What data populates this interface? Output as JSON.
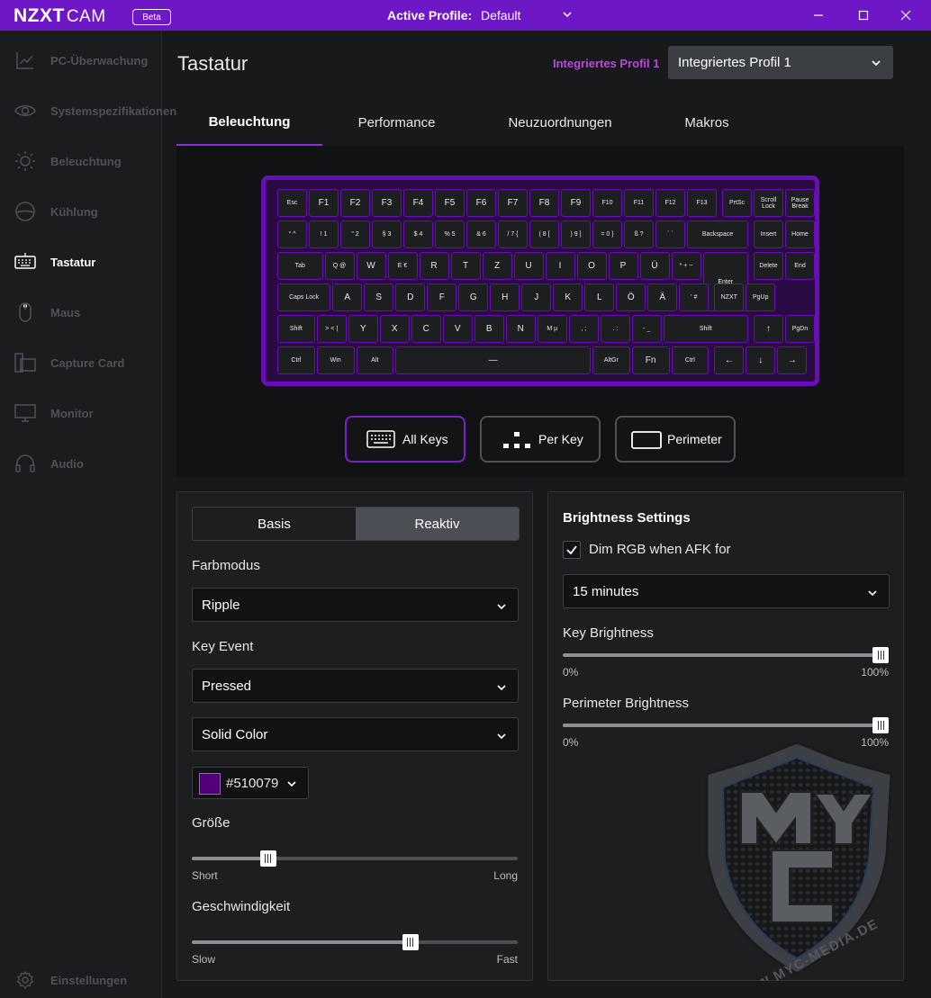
{
  "app": {
    "logo": "NZXT",
    "logo_suffix": "CAM",
    "badge": "Beta"
  },
  "titlebar": {
    "profile_label": "Active Profile:",
    "profile_value": "Default"
  },
  "sidebar": {
    "items": [
      {
        "label": "PC-Überwachung",
        "icon": "chart-line-icon"
      },
      {
        "label": "Systemspezifikationen",
        "icon": "eye-icon"
      },
      {
        "label": "Beleuchtung",
        "icon": "sun-icon"
      },
      {
        "label": "Kühlung",
        "icon": "cooler-icon"
      },
      {
        "label": "Tastatur",
        "icon": "keyboard-icon",
        "active": true
      },
      {
        "label": "Maus",
        "icon": "mouse-icon"
      },
      {
        "label": "Capture Card",
        "icon": "capture-card-icon"
      },
      {
        "label": "Monitor",
        "icon": "monitor-icon"
      },
      {
        "label": "Audio",
        "icon": "headset-icon"
      }
    ],
    "settings": "Einstellungen"
  },
  "header": {
    "title": "Tastatur",
    "profile_link": "Integriertes Profil 1",
    "profile_select": "Integriertes Profil 1"
  },
  "tabs": [
    "Beleuchtung",
    "Performance",
    "Neuzuordnungen",
    "Makros"
  ],
  "keyboard": {
    "rows": [
      [
        "Esc",
        "F1",
        "F2",
        "F3",
        "F4",
        "F5",
        "F6",
        "F7",
        "F8",
        "F9",
        "F10",
        "F11",
        "F12",
        "F13",
        "PrtSc",
        "Scroll Lock",
        "Pause Break"
      ],
      [
        "° ^",
        "! 1",
        "\" 2",
        "§ 3",
        "$ 4",
        "% 5",
        "& 6",
        "/ 7 {",
        "( 8 [",
        ") 9 ]",
        "= 0 }",
        "ß ?",
        "` ´",
        "Backspace",
        "Insert",
        "Home"
      ],
      [
        "Tab",
        "Q @",
        "W",
        "E €",
        "R",
        "T",
        "Z",
        "U",
        "I",
        "O",
        "P",
        "Ü",
        "* + ~",
        "Enter",
        "Delete",
        "End"
      ],
      [
        "Caps Lock",
        "A",
        "S",
        "D",
        "F",
        "G",
        "H",
        "J",
        "K",
        "L",
        "Ö",
        "Ä",
        "' #",
        "NZXT",
        "PgUp"
      ],
      [
        "Shift",
        "> < |",
        "Y",
        "X",
        "C",
        "V",
        "B",
        "N",
        "M µ",
        ", ;",
        ". :",
        "- _",
        "Shift",
        "↑",
        "PgDn"
      ],
      [
        "Ctrl",
        "Win",
        "Alt",
        "—",
        "AltGr",
        "Fn",
        "Ctrl",
        "←",
        "↓",
        "→"
      ]
    ]
  },
  "lighting_modes": [
    "All Keys",
    "Per Key",
    "Perimeter"
  ],
  "left_panel": {
    "segment": [
      "Basis",
      "Reaktiv"
    ],
    "farbmodus_label": "Farbmodus",
    "farbmodus_value": "Ripple",
    "key_event_label": "Key Event",
    "key_event_value": "Pressed",
    "color_mode_value": "Solid Color",
    "color_hex": "#510079",
    "size_label": "Größe",
    "size_min": "Short",
    "size_max": "Long",
    "size_value": 0.22,
    "speed_label": "Geschwindigkeit",
    "speed_min": "Slow",
    "speed_max": "Fast",
    "speed_value": 0.68
  },
  "right_panel": {
    "title": "Brightness Settings",
    "dim_label": "Dim RGB when AFK for",
    "dim_checked": true,
    "dim_value": "15 minutes",
    "key_brightness_label": "Key Brightness",
    "key_brightness_min": "0%",
    "key_brightness_max": "100%",
    "key_brightness_value": 1.0,
    "perimeter_brightness_label": "Perimeter Brightness",
    "perimeter_brightness_min": "0%",
    "perimeter_brightness_max": "100%",
    "perimeter_brightness_value": 1.0
  },
  "watermark_text": "WWW.MYC-MEDIA.DE",
  "colors": {
    "accent": "#6d17c7",
    "keyboard_border": "#6a0cb7",
    "swatch": "#510079"
  }
}
